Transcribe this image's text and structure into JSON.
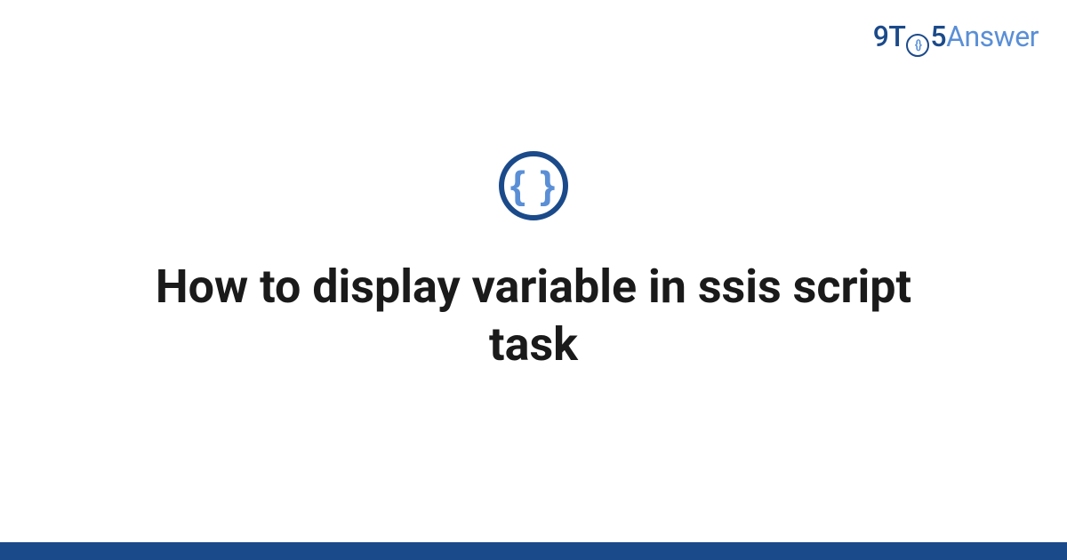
{
  "logo": {
    "part1": "9T",
    "circle_inner": "{}",
    "part2": "5",
    "part3": "Answer"
  },
  "icon": {
    "glyph": "{ }"
  },
  "title": "How to display variable in ssis script task"
}
